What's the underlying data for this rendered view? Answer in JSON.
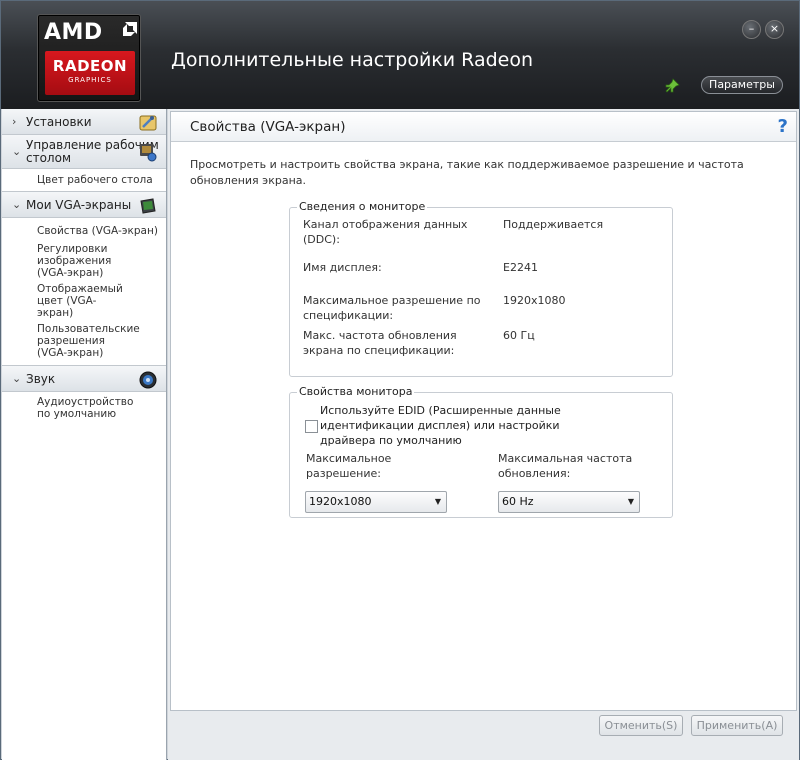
{
  "window": {
    "app_title": "Дополнительные настройки Radeon",
    "params_label": "Параметры",
    "minimize_glyph": "–",
    "close_glyph": "×"
  },
  "logo": {
    "brand": "AMD",
    "product": "RADEON",
    "sub": "GRAPHICS",
    "accent": "#d8181e"
  },
  "sidebar": {
    "sections": [
      {
        "arrow": "›",
        "label": "Установки",
        "icon": "settings-icon",
        "items": []
      },
      {
        "arrow": "⌄",
        "label": "Управление рабочим столом",
        "icon": "desktop-icon",
        "items": [
          "Цвет рабочего стола"
        ]
      },
      {
        "arrow": "⌄",
        "label": "Мои VGA-экраны",
        "icon": "monitor-icon",
        "items": [
          "Свойства (VGA-экран)",
          "Регулировки изображения (VGA-экран)",
          "Отображаемый цвет (VGA-экран)",
          "Пользовательские разрешения (VGA-экран)"
        ]
      },
      {
        "arrow": "⌄",
        "label": "Звук",
        "icon": "speaker-icon",
        "items": [
          "Аудиоустройство по умолчанию"
        ]
      }
    ]
  },
  "page": {
    "title": "Свойства (VGA-экран)",
    "help": "?",
    "description": "Просмотреть и настроить свойства экрана, такие как поддерживаемое разрешение и частота обновления экрана."
  },
  "monitor_info": {
    "legend": "Сведения о мониторе",
    "rows": [
      {
        "label": "Канал отображения данных (DDC):",
        "value": "Поддерживается"
      },
      {
        "label": "Имя дисплея:",
        "value": "E2241"
      },
      {
        "label": "Максимальное разрешение по спецификации:",
        "value": "1920x1080"
      },
      {
        "label": "Макс. частота обновления экрана по спецификации:",
        "value": "60 Гц"
      }
    ]
  },
  "monitor_props": {
    "legend": "Свойства монитора",
    "edid_label": "Используйте EDID (Расширенные данные идентификации дисплея) или настройки драйвера по умолчанию",
    "edid_checked": false,
    "max_res_label": "Максимальное разрешение:",
    "max_res_value": "1920x1080",
    "max_refresh_label": "Максимальная частота обновления:",
    "max_refresh_value": "60 Hz"
  },
  "footer": {
    "cancel_label": "Отменить(S)",
    "apply_label": "Применить(A)"
  }
}
